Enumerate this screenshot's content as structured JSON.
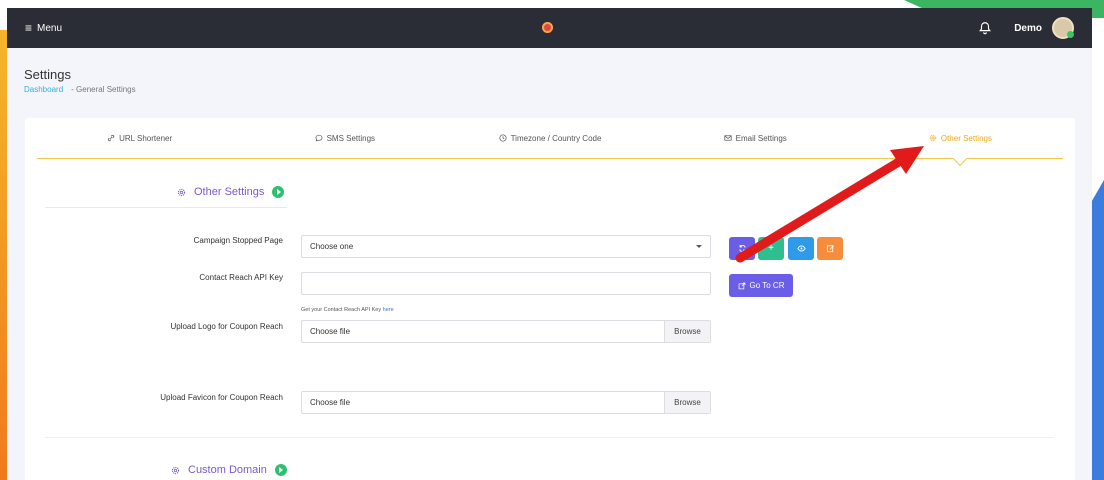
{
  "header": {
    "menu_label": "Menu",
    "user_name": "Demo"
  },
  "page": {
    "title": "Settings",
    "breadcrumb": [
      "Dashboard",
      "- General Settings"
    ]
  },
  "tabs": [
    {
      "label": "URL Shortener",
      "icon": "link-icon"
    },
    {
      "label": "SMS Settings",
      "icon": "chat-icon"
    },
    {
      "label": "Timezone / Country Code",
      "icon": "clock-icon"
    },
    {
      "label": "Email Settings",
      "icon": "mail-icon"
    },
    {
      "label": "Other Settings",
      "icon": "gear-icon",
      "active": true
    }
  ],
  "section": {
    "title": "Other Settings",
    "next_title": "Custom Domain"
  },
  "form": {
    "campaign_stopped": {
      "label": "Campaign Stopped Page",
      "value": "Choose one"
    },
    "api_key": {
      "label": "Contact Reach API Key",
      "value": "",
      "hint": "Get your Contact Reach API Key",
      "hint_link": "here"
    },
    "logo": {
      "label": "Upload Logo for Coupon Reach",
      "value": "Choose file",
      "browse": "Browse"
    },
    "favicon": {
      "label": "Upload Favicon for Coupon Reach",
      "value": "Choose file",
      "browse": "Browse"
    }
  },
  "buttons": {
    "refresh": {
      "icon": "refresh-icon",
      "color": "#6a5de6"
    },
    "add": {
      "label": "+",
      "color": "#2fbf8f"
    },
    "view": {
      "icon": "eye-icon",
      "color": "#2f9ae8"
    },
    "edit": {
      "icon": "edit-icon",
      "color": "#f58d3d"
    },
    "go_to_cr": "Go To CR"
  },
  "colors": {
    "accent": "#f0a91c",
    "section": "#7b59c8",
    "topbar": "#2a2d36",
    "annotation_arrow": "#e11b1b"
  }
}
